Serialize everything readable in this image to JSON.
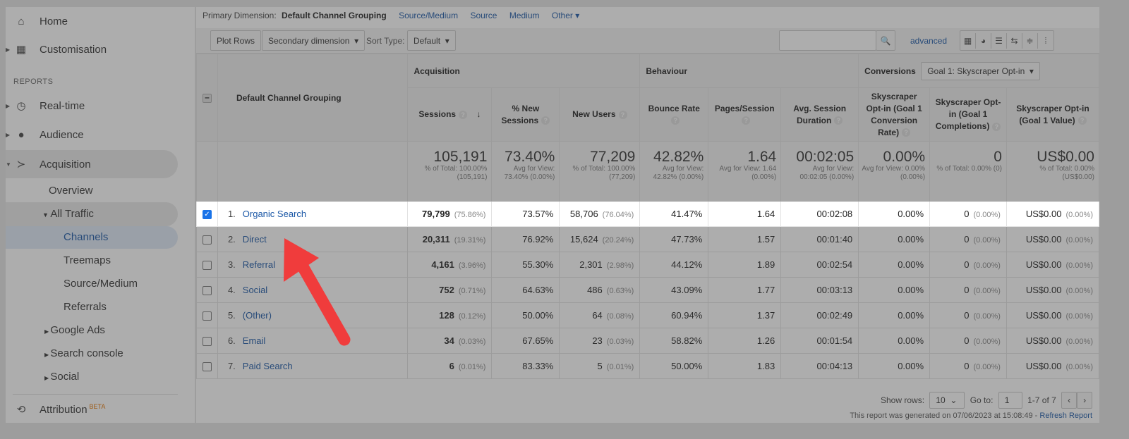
{
  "sidebar": {
    "home": "Home",
    "customisation": "Customisation",
    "reports_heading": "REPORTS",
    "realtime": "Real-time",
    "audience": "Audience",
    "acquisition": "Acquisition",
    "overview": "Overview",
    "all_traffic": "All Traffic",
    "channels": "Channels",
    "treemaps": "Treemaps",
    "source_medium": "Source/Medium",
    "referrals": "Referrals",
    "google_ads": "Google Ads",
    "search_console": "Search console",
    "social": "Social",
    "attribution": "Attribution",
    "beta": "BETA"
  },
  "primary_dimension": {
    "label": "Primary Dimension:",
    "selected": "Default Channel Grouping",
    "options": [
      "Source/Medium",
      "Source",
      "Medium",
      "Other"
    ]
  },
  "toolbar": {
    "plot_rows": "Plot Rows",
    "secondary_dimension": "Secondary dimension",
    "sort_type_label": "Sort Type:",
    "sort_type_value": "Default",
    "search_value": "",
    "advanced": "advanced"
  },
  "table": {
    "dimension_header": "Default Channel Grouping",
    "groups": {
      "acquisition": "Acquisition",
      "behaviour": "Behaviour",
      "conversions": "Conversions",
      "goal_select": "Goal 1: Skyscraper Opt-in"
    },
    "columns": [
      "Sessions",
      "% New Sessions",
      "New Users",
      "Bounce Rate",
      "Pages/Session",
      "Avg. Session Duration",
      "Skyscraper Opt-in (Goal 1 Conversion Rate)",
      "Skyscraper Opt-in (Goal 1 Completions)",
      "Skyscraper Opt-in (Goal 1 Value)"
    ],
    "totals": [
      {
        "value": "105,191",
        "sub": "% of Total: 100.00% (105,191)"
      },
      {
        "value": "73.40%",
        "sub": "Avg for View: 73.40% (0.00%)"
      },
      {
        "value": "77,209",
        "sub": "% of Total: 100.00% (77,209)"
      },
      {
        "value": "42.82%",
        "sub": "Avg for View: 42.82% (0.00%)"
      },
      {
        "value": "1.64",
        "sub": "Avg for View: 1.64 (0.00%)"
      },
      {
        "value": "00:02:05",
        "sub": "Avg for View: 00:02:05 (0.00%)"
      },
      {
        "value": "0.00%",
        "sub": "Avg for View: 0.00% (0.00%)"
      },
      {
        "value": "0",
        "sub": "% of Total: 0.00% (0)"
      },
      {
        "value": "US$0.00",
        "sub": "% of Total: 0.00% (US$0.00)"
      }
    ],
    "rows": [
      {
        "n": "1.",
        "name": "Organic Search",
        "checked": true,
        "sessions": "79,799",
        "sessions_pct": "(75.86%)",
        "new_sessions": "73.57%",
        "new_users": "58,706",
        "new_users_pct": "(76.04%)",
        "bounce": "41.47%",
        "pages": "1.64",
        "duration": "00:02:08",
        "conv_rate": "0.00%",
        "completions": "0",
        "completions_pct": "(0.00%)",
        "value": "US$0.00",
        "value_pct": "(0.00%)"
      },
      {
        "n": "2.",
        "name": "Direct",
        "checked": false,
        "sessions": "20,311",
        "sessions_pct": "(19.31%)",
        "new_sessions": "76.92%",
        "new_users": "15,624",
        "new_users_pct": "(20.24%)",
        "bounce": "47.73%",
        "pages": "1.57",
        "duration": "00:01:40",
        "conv_rate": "0.00%",
        "completions": "0",
        "completions_pct": "(0.00%)",
        "value": "US$0.00",
        "value_pct": "(0.00%)"
      },
      {
        "n": "3.",
        "name": "Referral",
        "checked": false,
        "sessions": "4,161",
        "sessions_pct": "(3.96%)",
        "new_sessions": "55.30%",
        "new_users": "2,301",
        "new_users_pct": "(2.98%)",
        "bounce": "44.12%",
        "pages": "1.89",
        "duration": "00:02:54",
        "conv_rate": "0.00%",
        "completions": "0",
        "completions_pct": "(0.00%)",
        "value": "US$0.00",
        "value_pct": "(0.00%)"
      },
      {
        "n": "4.",
        "name": "Social",
        "checked": false,
        "sessions": "752",
        "sessions_pct": "(0.71%)",
        "new_sessions": "64.63%",
        "new_users": "486",
        "new_users_pct": "(0.63%)",
        "bounce": "43.09%",
        "pages": "1.77",
        "duration": "00:03:13",
        "conv_rate": "0.00%",
        "completions": "0",
        "completions_pct": "(0.00%)",
        "value": "US$0.00",
        "value_pct": "(0.00%)"
      },
      {
        "n": "5.",
        "name": "(Other)",
        "checked": false,
        "sessions": "128",
        "sessions_pct": "(0.12%)",
        "new_sessions": "50.00%",
        "new_users": "64",
        "new_users_pct": "(0.08%)",
        "bounce": "60.94%",
        "pages": "1.37",
        "duration": "00:02:49",
        "conv_rate": "0.00%",
        "completions": "0",
        "completions_pct": "(0.00%)",
        "value": "US$0.00",
        "value_pct": "(0.00%)"
      },
      {
        "n": "6.",
        "name": "Email",
        "checked": false,
        "sessions": "34",
        "sessions_pct": "(0.03%)",
        "new_sessions": "67.65%",
        "new_users": "23",
        "new_users_pct": "(0.03%)",
        "bounce": "58.82%",
        "pages": "1.26",
        "duration": "00:01:54",
        "conv_rate": "0.00%",
        "completions": "0",
        "completions_pct": "(0.00%)",
        "value": "US$0.00",
        "value_pct": "(0.00%)"
      },
      {
        "n": "7.",
        "name": "Paid Search",
        "checked": false,
        "sessions": "6",
        "sessions_pct": "(0.01%)",
        "new_sessions": "83.33%",
        "new_users": "5",
        "new_users_pct": "(0.01%)",
        "bounce": "50.00%",
        "pages": "1.83",
        "duration": "00:04:13",
        "conv_rate": "0.00%",
        "completions": "0",
        "completions_pct": "(0.00%)",
        "value": "US$0.00",
        "value_pct": "(0.00%)"
      }
    ]
  },
  "footer": {
    "show_rows_label": "Show rows:",
    "show_rows_value": "10",
    "goto_label": "Go to:",
    "goto_value": "1",
    "range": "1-7 of 7",
    "generated": "This report was generated on 07/06/2023 at 15:08:49 - ",
    "refresh": "Refresh Report"
  },
  "annotation": {
    "arrow_color": "#f03c3c"
  },
  "colors": {
    "link": "#1a57a6",
    "checkbox": "#1a73e8"
  }
}
